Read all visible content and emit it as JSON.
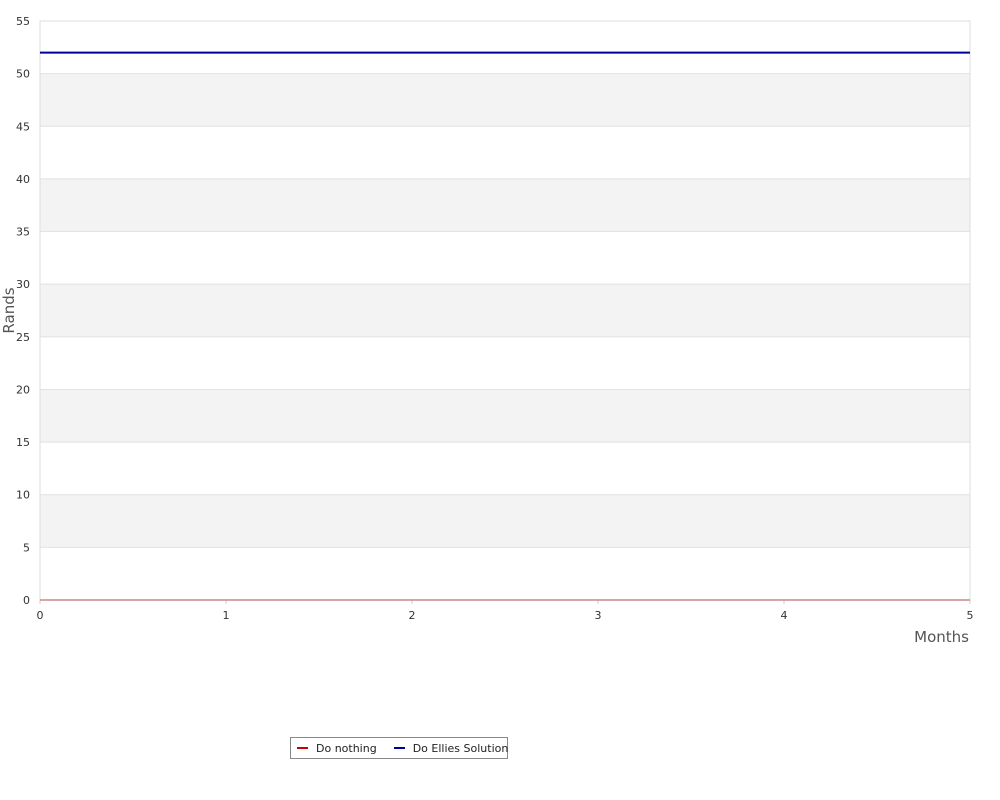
{
  "chart_data": {
    "type": "line",
    "title": "",
    "xlabel": "Months",
    "ylabel": "Rands",
    "xlim": [
      0,
      5
    ],
    "ylim": [
      0,
      55
    ],
    "xticks": [
      0,
      1,
      2,
      3,
      4,
      5
    ],
    "yticks": [
      0,
      5,
      10,
      15,
      20,
      25,
      30,
      35,
      40,
      45,
      50,
      55
    ],
    "grid": true,
    "banded_background": true,
    "legend_position": "bottom",
    "x": [
      0,
      1,
      2,
      3,
      4,
      5
    ],
    "series": [
      {
        "name": "Do nothing",
        "color": "#cc0000",
        "values": [
          0,
          0,
          0,
          0,
          0,
          0
        ]
      },
      {
        "name": "Do Ellies Solution",
        "color": "#000099",
        "values": [
          52,
          52,
          52,
          52,
          52,
          52
        ]
      }
    ]
  }
}
